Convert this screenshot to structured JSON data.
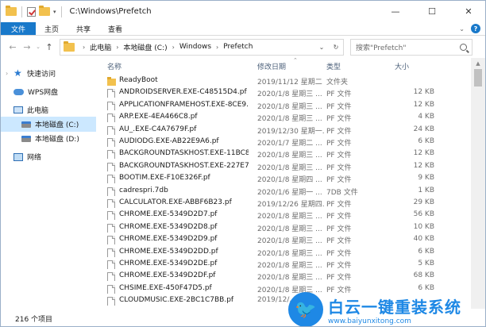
{
  "window": {
    "title": "C:\\Windows\\Prefetch"
  },
  "titlebar": {
    "controls": [
      "—",
      "☐",
      "✕"
    ]
  },
  "ribbon": {
    "tabs": [
      "文件",
      "主页",
      "共享",
      "查看"
    ]
  },
  "address": {
    "segments": [
      "此电脑",
      "本地磁盘 (C:)",
      "Windows",
      "Prefetch"
    ]
  },
  "search": {
    "placeholder": "搜索\"Prefetch\""
  },
  "sidebar": {
    "items": [
      {
        "label": "快速访问",
        "icon": "star-icon"
      },
      {
        "label": "WPS网盘",
        "icon": "cloud-icon"
      },
      {
        "label": "此电脑",
        "icon": "computer-icon"
      },
      {
        "label": "本地磁盘 (C:)",
        "icon": "drive-icon",
        "selected": true
      },
      {
        "label": "本地磁盘 (D:)",
        "icon": "drive-icon"
      },
      {
        "label": "网络",
        "icon": "network-icon"
      }
    ]
  },
  "columns": {
    "name": "名称",
    "date": "修改日期",
    "type": "类型",
    "size": "大小"
  },
  "files": [
    {
      "name": "ReadyBoot",
      "date": "2019/11/12 星期二",
      "type": "文件夹",
      "size": "",
      "kind": "folder"
    },
    {
      "name": "ANDROIDSERVER.EXE-C48515D4.pf",
      "date": "2020/1/8 星期三 ...",
      "type": "PF 文件",
      "size": "12 KB",
      "kind": "file"
    },
    {
      "name": "APPLICATIONFRAMEHOST.EXE-8CE9...",
      "date": "2020/1/8 星期三 ...",
      "type": "PF 文件",
      "size": "12 KB",
      "kind": "file"
    },
    {
      "name": "ARP.EXE-4EA466C8.pf",
      "date": "2020/1/8 星期三 ...",
      "type": "PF 文件",
      "size": "4 KB",
      "kind": "file"
    },
    {
      "name": "AU_.EXE-C4A7679F.pf",
      "date": "2019/12/30 星期一...",
      "type": "PF 文件",
      "size": "24 KB",
      "kind": "file"
    },
    {
      "name": "AUDIODG.EXE-AB22E9A6.pf",
      "date": "2020/1/7 星期二 ...",
      "type": "PF 文件",
      "size": "6 KB",
      "kind": "file"
    },
    {
      "name": "BACKGROUNDTASKHOST.EXE-11BC8...",
      "date": "2020/1/8 星期三 ...",
      "type": "PF 文件",
      "size": "12 KB",
      "kind": "file"
    },
    {
      "name": "BACKGROUNDTASKHOST.EXE-227E7...",
      "date": "2020/1/8 星期三 ...",
      "type": "PF 文件",
      "size": "12 KB",
      "kind": "file"
    },
    {
      "name": "BOOTIM.EXE-F10E326F.pf",
      "date": "2020/1/8 星期四 ...",
      "type": "PF 文件",
      "size": "9 KB",
      "kind": "file"
    },
    {
      "name": "cadrespri.7db",
      "date": "2020/1/6 星期一 ...",
      "type": "7DB 文件",
      "size": "1 KB",
      "kind": "file"
    },
    {
      "name": "CALCULATOR.EXE-ABBF6B23.pf",
      "date": "2019/12/26 星期四...",
      "type": "PF 文件",
      "size": "29 KB",
      "kind": "file"
    },
    {
      "name": "CHROME.EXE-5349D2D7.pf",
      "date": "2020/1/8 星期三 ...",
      "type": "PF 文件",
      "size": "56 KB",
      "kind": "file"
    },
    {
      "name": "CHROME.EXE-5349D2D8.pf",
      "date": "2020/1/8 星期三 ...",
      "type": "PF 文件",
      "size": "10 KB",
      "kind": "file"
    },
    {
      "name": "CHROME.EXE-5349D2D9.pf",
      "date": "2020/1/8 星期三 ...",
      "type": "PF 文件",
      "size": "40 KB",
      "kind": "file"
    },
    {
      "name": "CHROME.EXE-5349D2DD.pf",
      "date": "2020/1/8 星期三 ...",
      "type": "PF 文件",
      "size": "6 KB",
      "kind": "file"
    },
    {
      "name": "CHROME.EXE-5349D2DE.pf",
      "date": "2020/1/8 星期三 ...",
      "type": "PF 文件",
      "size": "5 KB",
      "kind": "file"
    },
    {
      "name": "CHROME.EXE-5349D2DF.pf",
      "date": "2020/1/8 星期三 ...",
      "type": "PF 文件",
      "size": "68 KB",
      "kind": "file"
    },
    {
      "name": "CHSIME.EXE-450F47D5.pf",
      "date": "2020/1/8 星期三 ...",
      "type": "PF 文件",
      "size": "6 KB",
      "kind": "file"
    },
    {
      "name": "CLOUDMUSIC.EXE-2BC1C7BB.pf",
      "date": "2019/12/...",
      "type": "",
      "size": "",
      "kind": "file"
    }
  ],
  "status": {
    "count": "216 个项目"
  },
  "watermark": {
    "title": "白云一键重装系统",
    "url": "www.baiyunxitong.com"
  },
  "colors": {
    "accent": "#1979ca",
    "selected": "#cce8ff"
  }
}
